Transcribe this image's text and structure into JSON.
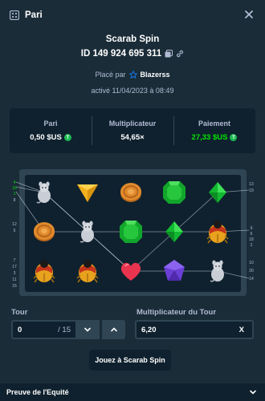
{
  "header": {
    "title": "Pari"
  },
  "bet": {
    "game_name": "Scarab Spin",
    "id_label": "ID 149 924 695 311",
    "placed_prefix": "Placé par",
    "username": "Blazerss",
    "activated": "activé 11/04/2023 à 08:49"
  },
  "stats": {
    "bet_label": "Pari",
    "bet_value": "0,50 $US",
    "mult_label": "Multiplicateur",
    "mult_value": "54,65×",
    "payout_label": "Paiement",
    "payout_value": "27,33 $US"
  },
  "board": {
    "line_numbers_left": [
      "4",
      "16",
      "1",
      "8",
      "12",
      "5",
      "7",
      "17",
      "3",
      "11",
      "15"
    ],
    "line_numbers_right": [
      "13",
      "19",
      "9",
      "6",
      "18",
      "2",
      "10",
      "20",
      "14"
    ],
    "grid": [
      [
        "mouse",
        "triangle-gem",
        "coin",
        "emerald",
        "green-diamond"
      ],
      [
        "coin",
        "mouse",
        "emerald",
        "green-diamond",
        "scarab"
      ],
      [
        "scarab",
        "scarab",
        "heart",
        "purple-gem",
        "mouse"
      ]
    ]
  },
  "controls": {
    "round_label": "Tour",
    "round_value": "0",
    "round_total": "/ 15",
    "round_mult_label": "Multiplicateur du Tour",
    "round_mult_value": "6,20",
    "clear_label": "X"
  },
  "play_label": "Jouez à Scarab Spin",
  "footer": {
    "label": "Preuve de l'Equité"
  },
  "colors": {
    "bg": "#1a2c38",
    "panel": "#0f212e",
    "border": "#2f4553",
    "green": "#00e701",
    "muted": "#b1bad3"
  }
}
